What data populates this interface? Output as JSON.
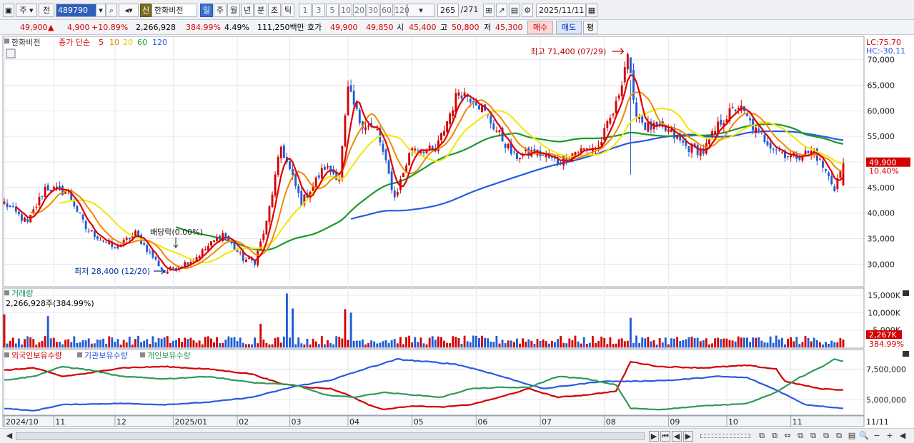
{
  "toolbar": {
    "market": "주",
    "all": "전",
    "code": "489790",
    "badge": "신",
    "name": "한화비전",
    "periods": [
      "일",
      "주",
      "월",
      "년",
      "분",
      "초",
      "틱"
    ],
    "active_period": "일",
    "minutes": [
      "1",
      "3",
      "5",
      "10",
      "20",
      "30",
      "60",
      "120"
    ],
    "count": "265",
    "total": "/271",
    "date": "2025/11/11"
  },
  "quote": {
    "price": "49,900",
    "change_arrow": "▲",
    "change": "4,900",
    "change_pct": "+10.89%",
    "volume": "2,266,928",
    "volume_ratio": "384.99%",
    "turnover": "4.49%",
    "amount": "111,250백만",
    "hoga_label": "호가",
    "ask": "49,900",
    "bid": "49,850",
    "open_label": "시",
    "open": "45,400",
    "high_label": "고",
    "high": "50,800",
    "low_label": "저",
    "low": "45,300",
    "buy_label": "매수",
    "sell_label": "매도",
    "avg_label": "평"
  },
  "colors": {
    "up": "#d40000",
    "down": "#1f5bd6",
    "ma5": "#e00000",
    "ma10": "#f08a00",
    "ma20": "#f2e600",
    "ma60": "#1a9a2a",
    "ma120": "#2a5ae0",
    "foreign": "#d40000",
    "institution": "#2a5ae0",
    "individual": "#2f9a5a"
  },
  "chart_data": [
    {
      "type": "candlestick",
      "legend_name": "한화비전",
      "legend_prefix": "종가 단순",
      "ma_periods": [
        "5",
        "10",
        "20",
        "60",
        "120"
      ],
      "lc": "LC:75.70",
      "hc": "HC:-30.11",
      "ylim": [
        26000,
        74000
      ],
      "y_ticks": [
        30000,
        35000,
        40000,
        45000,
        50000,
        55000,
        60000,
        65000,
        70000
      ],
      "y_tick_labels": [
        "30,000",
        "35,000",
        "40,000",
        "45,000",
        "50,000",
        "55,000",
        "60,000",
        "65,000",
        "70,000"
      ],
      "current_price_label": "49,900",
      "current_pct_label": "10.40%",
      "current_value": 49900,
      "annotations": {
        "high": {
          "text": "최고 71,400 (07/29)",
          "value": 71400
        },
        "low": {
          "text": "최저 28,400 (12/20)",
          "value": 28400
        },
        "ex_dividend": {
          "text": "배당락(0.00%)"
        }
      },
      "x_labels": [
        "2024/10",
        "11",
        "12",
        "2025/01",
        "02",
        "03",
        "04",
        "05",
        "06",
        "07",
        "08",
        "09",
        "10",
        "11"
      ],
      "x_right_label": "11/11",
      "keypoints": [
        [
          0,
          42000
        ],
        [
          8,
          38000
        ],
        [
          14,
          45000
        ],
        [
          22,
          44000
        ],
        [
          28,
          37000
        ],
        [
          38,
          33000
        ],
        [
          45,
          36000
        ],
        [
          55,
          28400
        ],
        [
          65,
          31000
        ],
        [
          75,
          36000
        ],
        [
          82,
          31000
        ],
        [
          86,
          30500
        ],
        [
          90,
          38000
        ],
        [
          95,
          53000
        ],
        [
          102,
          42000
        ],
        [
          110,
          49000
        ],
        [
          115,
          47000
        ],
        [
          118,
          64000
        ],
        [
          122,
          58000
        ],
        [
          128,
          56000
        ],
        [
          134,
          43000
        ],
        [
          140,
          53000
        ],
        [
          148,
          52000
        ],
        [
          156,
          64000
        ],
        [
          162,
          62000
        ],
        [
          168,
          57000
        ],
        [
          175,
          51000
        ],
        [
          182,
          52000
        ],
        [
          190,
          50000
        ],
        [
          196,
          52000
        ],
        [
          204,
          53000
        ],
        [
          210,
          61000
        ],
        [
          214,
          71400
        ],
        [
          216,
          61000
        ],
        [
          220,
          57000
        ],
        [
          228,
          56000
        ],
        [
          234,
          53000
        ],
        [
          240,
          52000
        ],
        [
          246,
          58000
        ],
        [
          252,
          61000
        ],
        [
          258,
          56000
        ],
        [
          264,
          53000
        ],
        [
          270,
          51000
        ],
        [
          278,
          52000
        ],
        [
          285,
          45000
        ],
        [
          288,
          49900
        ]
      ]
    },
    {
      "type": "bar",
      "name": "거래량",
      "current_text": "2,266,928주(384.99%)",
      "ylim": [
        0,
        16000000
      ],
      "y_ticks": [
        5000000,
        10000000,
        15000000
      ],
      "y_tick_labels": [
        "5,000K",
        "10,000K",
        "15,000K"
      ],
      "current_label": "2,267K",
      "current_pct": "384.99%",
      "spikes": [
        [
          97,
          15500000
        ],
        [
          99,
          11200000
        ],
        [
          117,
          11000000
        ],
        [
          119,
          10000000
        ],
        [
          88,
          6800000
        ],
        [
          215,
          8500000
        ],
        [
          15,
          9000000
        ],
        [
          0,
          9500000
        ]
      ]
    },
    {
      "type": "line",
      "series_names": [
        "외국인보유수량",
        "기관보유수량",
        "개인보유수량"
      ],
      "ylim": [
        3800000,
        8800000
      ],
      "y_ticks": [
        5000000,
        7500000
      ],
      "y_tick_labels": [
        "5,000,000",
        "7,500,000"
      ],
      "foreign": [
        [
          0,
          7.4
        ],
        [
          10,
          7.6
        ],
        [
          20,
          6.9
        ],
        [
          30,
          7.2
        ],
        [
          40,
          7.6
        ],
        [
          55,
          7.7
        ],
        [
          70,
          7.5
        ],
        [
          85,
          7.1
        ],
        [
          95,
          6.3
        ],
        [
          105,
          6.0
        ],
        [
          112,
          5.9
        ],
        [
          118,
          5.4
        ],
        [
          125,
          4.6
        ],
        [
          130,
          4.2
        ],
        [
          140,
          4.5
        ],
        [
          150,
          4.4
        ],
        [
          160,
          4.6
        ],
        [
          170,
          5.2
        ],
        [
          180,
          5.9
        ],
        [
          190,
          5.2
        ],
        [
          200,
          5.4
        ],
        [
          210,
          5.7
        ],
        [
          215,
          8.1
        ],
        [
          225,
          7.7
        ],
        [
          240,
          7.6
        ],
        [
          255,
          7.8
        ],
        [
          265,
          7.5
        ],
        [
          268,
          6.5
        ],
        [
          280,
          5.9
        ],
        [
          288,
          5.8
        ]
      ],
      "institution": [
        [
          0,
          4.3
        ],
        [
          10,
          4.1
        ],
        [
          20,
          4.6
        ],
        [
          40,
          4.7
        ],
        [
          55,
          4.6
        ],
        [
          70,
          4.8
        ],
        [
          85,
          5.2
        ],
        [
          100,
          6.1
        ],
        [
          112,
          6.6
        ],
        [
          125,
          7.6
        ],
        [
          135,
          8.3
        ],
        [
          145,
          8.1
        ],
        [
          155,
          7.9
        ],
        [
          165,
          7.3
        ],
        [
          175,
          6.6
        ],
        [
          185,
          5.9
        ],
        [
          195,
          6.2
        ],
        [
          205,
          6.5
        ],
        [
          215,
          6.5
        ],
        [
          230,
          6.6
        ],
        [
          245,
          6.9
        ],
        [
          255,
          6.8
        ],
        [
          265,
          5.8
        ],
        [
          275,
          4.6
        ],
        [
          288,
          4.3
        ]
      ],
      "individual": [
        [
          0,
          6.6
        ],
        [
          10,
          6.9
        ],
        [
          20,
          7.7
        ],
        [
          30,
          7.4
        ],
        [
          40,
          6.9
        ],
        [
          55,
          6.7
        ],
        [
          70,
          6.9
        ],
        [
          85,
          6.4
        ],
        [
          100,
          6.2
        ],
        [
          110,
          5.4
        ],
        [
          120,
          5.2
        ],
        [
          130,
          5.6
        ],
        [
          140,
          5.4
        ],
        [
          150,
          5.2
        ],
        [
          160,
          5.9
        ],
        [
          170,
          6.0
        ],
        [
          180,
          6.0
        ],
        [
          190,
          6.9
        ],
        [
          200,
          6.7
        ],
        [
          210,
          6.2
        ],
        [
          215,
          4.3
        ],
        [
          225,
          4.2
        ],
        [
          240,
          4.5
        ],
        [
          255,
          4.7
        ],
        [
          265,
          5.6
        ],
        [
          272,
          6.7
        ],
        [
          280,
          7.6
        ],
        [
          285,
          8.3
        ],
        [
          288,
          8.1
        ]
      ]
    }
  ],
  "bottom": {
    "nav": [
      "▶",
      "⏮",
      "◀",
      "▶"
    ],
    "tools": [
      "🔍",
      "−",
      "+",
      "◀"
    ]
  }
}
